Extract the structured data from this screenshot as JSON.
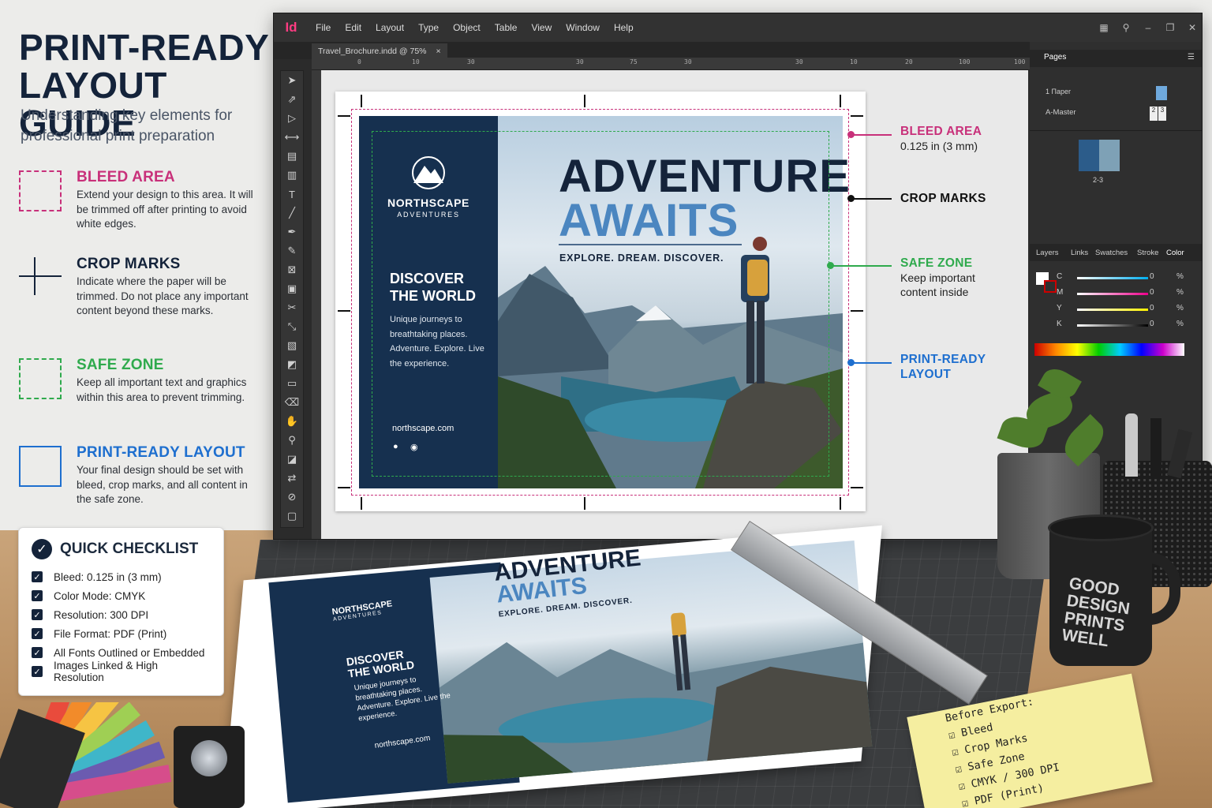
{
  "guide": {
    "title_line1": "PRINT-READY",
    "title_line2": "LAYOUT GUIDE",
    "subtitle": "Understanding key elements for professional print preparation",
    "items": [
      {
        "heading": "BLEED AREA",
        "text": "Extend your design to this area. It will be trimmed off after printing to avoid white edges.",
        "color": "#c8307a"
      },
      {
        "heading": "CROP MARKS",
        "text": "Indicate where the paper will be trimmed. Do not place any important content beyond these marks.",
        "color": "#14233a"
      },
      {
        "heading": "SAFE ZONE",
        "text": "Keep all important text and graphics within this area to prevent trimming.",
        "color": "#2faa4d"
      },
      {
        "heading": "PRINT-READY LAYOUT",
        "text": "Your final design should be set with bleed, crop marks, and all content in the safe zone.",
        "color": "#1e6fcf"
      }
    ]
  },
  "checklist": {
    "title": "QUICK CHECKLIST",
    "items": [
      "Bleed: 0.125 in (3 mm)",
      "Color Mode: CMYK",
      "Resolution: 300 DPI",
      "File Format: PDF (Print)",
      "All Fonts Outlined or Embedded",
      "Images Linked & High Resolution"
    ]
  },
  "app": {
    "logo": "Id",
    "menu": [
      "File",
      "Edit",
      "Layout",
      "Type",
      "Object",
      "Table",
      "View",
      "Window",
      "Help"
    ],
    "tab_title": "Travel_Brochure.indd @ 75%",
    "tab_close": "×",
    "ruler_ticks": [
      "0",
      "10",
      "30",
      "30",
      "75",
      "30",
      "30",
      "10",
      "20",
      "100",
      "100"
    ],
    "panels": {
      "pages_tab": "Pages",
      "page_1": "1 Парer",
      "master": "A-Master",
      "master_pages": [
        "2",
        "3"
      ],
      "spread_label": "2-3",
      "color_tabs": [
        "Layers",
        "Links",
        "Swatches",
        "Stroke",
        "Color"
      ],
      "cmyk": [
        {
          "label": "C",
          "value": "0",
          "unit": "%"
        },
        {
          "label": "M",
          "value": "0",
          "unit": "%"
        },
        {
          "label": "Y",
          "value": "0",
          "unit": "%"
        },
        {
          "label": "K",
          "value": "0",
          "unit": "%"
        }
      ]
    }
  },
  "flyer": {
    "brand_name": "NORTHSCAPE",
    "brand_sub": "ADVENTURES",
    "side_heading_1": "DISCOVER",
    "side_heading_2": "THE WORLD",
    "side_text": "Unique journeys to breathtaking places. Adventure. Explore. Live the experience.",
    "url": "northscape.com",
    "headline_1": "ADVENTURE",
    "headline_2": "AWAITS",
    "tagline": "EXPLORE. DREAM. DISCOVER."
  },
  "callouts": [
    {
      "heading": "BLEED AREA",
      "sub": "0.125 in (3 mm)",
      "color": "#c8307a"
    },
    {
      "heading": "CROP MARKS",
      "sub": "",
      "color": "#111111"
    },
    {
      "heading": "SAFE ZONE",
      "sub": "Keep important content inside",
      "color": "#2faa4d"
    },
    {
      "heading": "PRINT-READY LAYOUT",
      "sub": "",
      "color": "#1e6fcf"
    }
  ],
  "desk": {
    "printed_headline_1": "ADVENTURE",
    "printed_headline_2": "AWAITS",
    "printed_tagline": "EXPLORE. DREAM. DISCOVER.",
    "printed_brand": "NORTHSCAPE",
    "printed_brand_sub": "ADVENTURES",
    "printed_heading_1": "DISCOVER",
    "printed_heading_2": "THE WORLD",
    "printed_text": "Unique journeys to breathtaking places. Adventure. Explore. Live the experience.",
    "printed_url": "northscape.com",
    "mug_text": [
      "GOOD",
      "DESIGN",
      "PRINTS",
      "WELL"
    ],
    "note_title": "Before Export:",
    "note_items": [
      "Bleed",
      "Crop Marks",
      "Safe Zone",
      "CMYK / 300 DPI",
      "PDF (Print)"
    ]
  }
}
